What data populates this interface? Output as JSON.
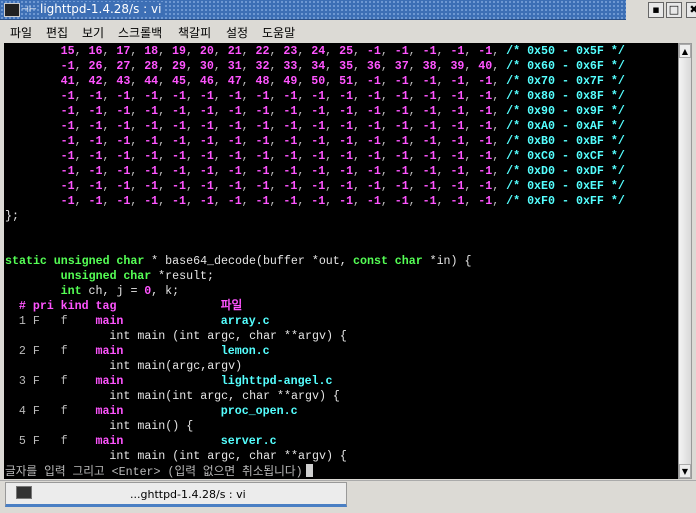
{
  "window": {
    "title": "lighttpd-1.4.28/s : vi",
    "minimize": "▪",
    "maximize": "□",
    "close": "✖"
  },
  "menu": [
    "파일",
    "편집",
    "보기",
    "스크롤백",
    "책갈피",
    "설정",
    "도움말"
  ],
  "table": {
    "rows": [
      {
        "values": [
          "15",
          "16",
          "17",
          "18",
          "19",
          "20",
          "21",
          "22",
          "23",
          "24",
          "25",
          "-1",
          "-1",
          "-1",
          "-1",
          "-1"
        ],
        "comment": "/* 0x50 - 0x5F */"
      },
      {
        "values": [
          "-1",
          "26",
          "27",
          "28",
          "29",
          "30",
          "31",
          "32",
          "33",
          "34",
          "35",
          "36",
          "37",
          "38",
          "39",
          "40"
        ],
        "comment": "/* 0x60 - 0x6F */"
      },
      {
        "values": [
          "41",
          "42",
          "43",
          "44",
          "45",
          "46",
          "47",
          "48",
          "49",
          "50",
          "51",
          "-1",
          "-1",
          "-1",
          "-1",
          "-1"
        ],
        "comment": "/* 0x70 - 0x7F */"
      },
      {
        "values": [
          "-1",
          "-1",
          "-1",
          "-1",
          "-1",
          "-1",
          "-1",
          "-1",
          "-1",
          "-1",
          "-1",
          "-1",
          "-1",
          "-1",
          "-1",
          "-1"
        ],
        "comment": "/* 0x80 - 0x8F */"
      },
      {
        "values": [
          "-1",
          "-1",
          "-1",
          "-1",
          "-1",
          "-1",
          "-1",
          "-1",
          "-1",
          "-1",
          "-1",
          "-1",
          "-1",
          "-1",
          "-1",
          "-1"
        ],
        "comment": "/* 0x90 - 0x9F */"
      },
      {
        "values": [
          "-1",
          "-1",
          "-1",
          "-1",
          "-1",
          "-1",
          "-1",
          "-1",
          "-1",
          "-1",
          "-1",
          "-1",
          "-1",
          "-1",
          "-1",
          "-1"
        ],
        "comment": "/* 0xA0 - 0xAF */"
      },
      {
        "values": [
          "-1",
          "-1",
          "-1",
          "-1",
          "-1",
          "-1",
          "-1",
          "-1",
          "-1",
          "-1",
          "-1",
          "-1",
          "-1",
          "-1",
          "-1",
          "-1"
        ],
        "comment": "/* 0xB0 - 0xBF */"
      },
      {
        "values": [
          "-1",
          "-1",
          "-1",
          "-1",
          "-1",
          "-1",
          "-1",
          "-1",
          "-1",
          "-1",
          "-1",
          "-1",
          "-1",
          "-1",
          "-1",
          "-1"
        ],
        "comment": "/* 0xC0 - 0xCF */"
      },
      {
        "values": [
          "-1",
          "-1",
          "-1",
          "-1",
          "-1",
          "-1",
          "-1",
          "-1",
          "-1",
          "-1",
          "-1",
          "-1",
          "-1",
          "-1",
          "-1",
          "-1"
        ],
        "comment": "/* 0xD0 - 0xDF */"
      },
      {
        "values": [
          "-1",
          "-1",
          "-1",
          "-1",
          "-1",
          "-1",
          "-1",
          "-1",
          "-1",
          "-1",
          "-1",
          "-1",
          "-1",
          "-1",
          "-1",
          "-1"
        ],
        "comment": "/* 0xE0 - 0xEF */"
      },
      {
        "values": [
          "-1",
          "-1",
          "-1",
          "-1",
          "-1",
          "-1",
          "-1",
          "-1",
          "-1",
          "-1",
          "-1",
          "-1",
          "-1",
          "-1",
          "-1",
          "-1"
        ],
        "comment": "/* 0xF0 - 0xFF */"
      }
    ],
    "separator": ",",
    "close": "};"
  },
  "code": [
    [
      [
        "static",
        "k"
      ],
      [
        " ",
        ""
      ],
      [
        "unsigned",
        "k"
      ],
      [
        " ",
        ""
      ],
      [
        "char",
        "k"
      ],
      [
        " * base64_decode(buffer *out, ",
        ""
      ],
      [
        "const",
        "k"
      ],
      [
        " ",
        ""
      ],
      [
        "char",
        "k"
      ],
      [
        " *in) {",
        ""
      ]
    ],
    [
      [
        "        ",
        ""
      ],
      [
        "unsigned",
        "k"
      ],
      [
        " ",
        ""
      ],
      [
        "char",
        "k"
      ],
      [
        " *result;",
        ""
      ]
    ],
    [
      [
        "        ",
        ""
      ],
      [
        "int",
        "k"
      ],
      [
        " ch, j = ",
        ""
      ],
      [
        "0",
        "n"
      ],
      [
        ", k;",
        ""
      ]
    ]
  ],
  "tags": {
    "header": [
      "#",
      "pri",
      "kind",
      "tag",
      "파일"
    ],
    "items": [
      {
        "num": "1",
        "pri": "F",
        "kind": "f",
        "tag": "main",
        "file": "array.c",
        "pattern": "int main (int argc, char **argv) {"
      },
      {
        "num": "2",
        "pri": "F",
        "kind": "f",
        "tag": "main",
        "file": "lemon.c",
        "pattern": "int main(argc,argv)"
      },
      {
        "num": "3",
        "pri": "F",
        "kind": "f",
        "tag": "main",
        "file": "lighttpd-angel.c",
        "pattern": "int main(int argc, char **argv) {"
      },
      {
        "num": "4",
        "pri": "F",
        "kind": "f",
        "tag": "main",
        "file": "proc_open.c",
        "pattern": "int main() {"
      },
      {
        "num": "5",
        "pri": "F",
        "kind": "f",
        "tag": "main",
        "file": "server.c",
        "pattern": "int main (int argc, char **argv) {"
      }
    ]
  },
  "prompt": "글자를 입력 그리고 <Enter> (입력 없으면 취소됩니다)",
  "taskbar": {
    "label": "...ghttpd-1.4.28/s : vi"
  },
  "colors": {
    "number": "#ff55ff",
    "comment": "#55ffff",
    "keyword": "#55ff55",
    "text": "#e5e5e5"
  }
}
